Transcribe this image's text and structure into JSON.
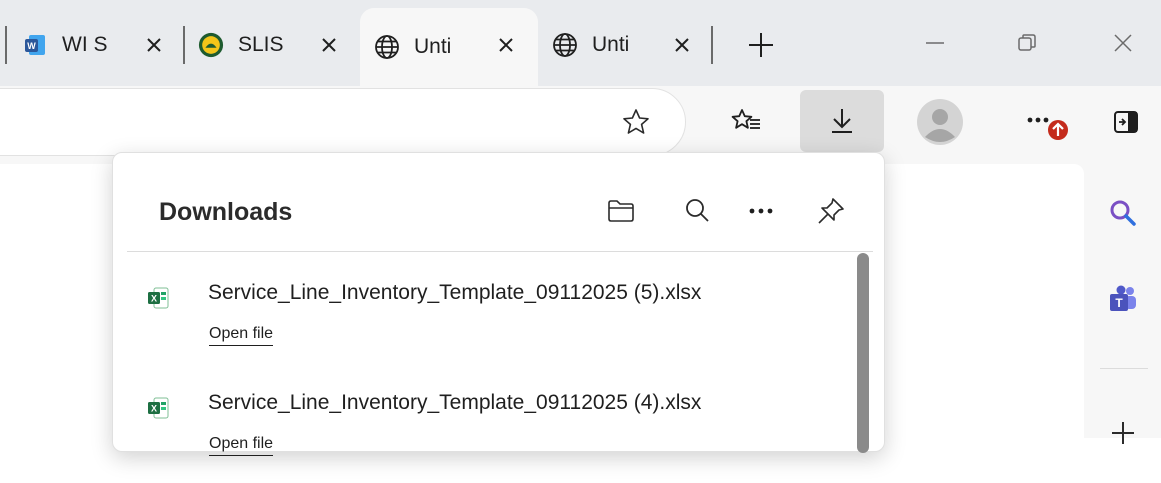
{
  "tabs": [
    {
      "title": "WI S",
      "icon": "word-icon",
      "active": false
    },
    {
      "title": "SLIS",
      "icon": "slis-logo-icon",
      "active": false
    },
    {
      "title": "Unti",
      "icon": "globe-icon",
      "active": true
    },
    {
      "title": "Unti",
      "icon": "globe-icon",
      "active": false
    }
  ],
  "window_controls": [
    "minimize",
    "restore",
    "close"
  ],
  "toolbar": {
    "icons": [
      "favorite-star-icon",
      "favorites-list-icon",
      "download-icon",
      "profile-avatar-icon",
      "more-menu-icon",
      "split-screen-icon"
    ],
    "notification_badge_color": "#c42b1c"
  },
  "downloads": {
    "title": "Downloads",
    "header_icons": [
      "open-folder-icon",
      "search-icon",
      "more-options-icon",
      "pin-icon"
    ],
    "items": [
      {
        "filename": "Service_Line_Inventory_Template_09112025 (5).xlsx",
        "action": "Open file"
      },
      {
        "filename": "Service_Line_Inventory_Template_09112025 (4).xlsx",
        "action": "Open file"
      }
    ]
  },
  "sidebar": {
    "icons": [
      "search-icon",
      "teams-icon",
      "add-icon"
    ]
  },
  "colors": {
    "excel_green": "#1d6f42",
    "word_blue": "#2b579a",
    "teams_purple": "#5059c9",
    "search_purple": "#7a4fc4"
  }
}
